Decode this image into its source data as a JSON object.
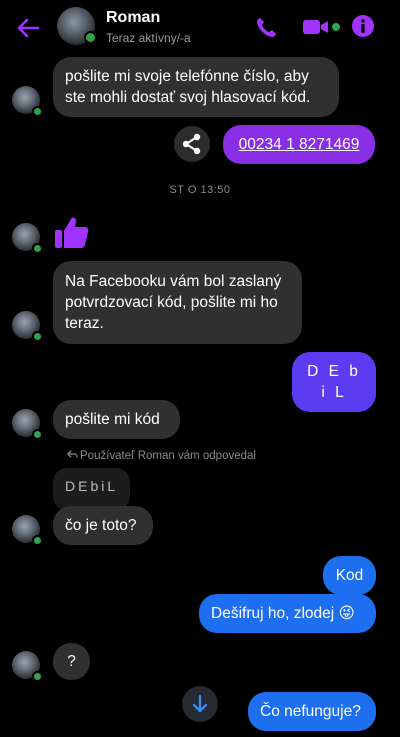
{
  "header": {
    "contact_name": "Roman",
    "status": "Teraz aktívny/-a",
    "back_icon": "back-arrow-icon",
    "call_icon": "phone-icon",
    "video_icon": "video-camera-icon",
    "info_icon": "info-icon",
    "accent_color": "#a033ff"
  },
  "messages": [
    {
      "from": "Roman",
      "text": "pošlite mi svoje telefónne číslo, aby ste mohli dostať svoj hlasovací kód."
    },
    {
      "from": "me",
      "text": "00234 1 8271469"
    },
    {
      "type": "timestamp",
      "text": "ST O 13:50"
    },
    {
      "from": "Roman",
      "text": "👍"
    },
    {
      "from": "Roman",
      "text": "Na Facebooku vám bol zaslaný potvrdzovací kód, pošlite mi ho teraz."
    },
    {
      "from": "me",
      "text": "D E b i L"
    },
    {
      "from": "Roman",
      "text": "pošlite mi kód"
    },
    {
      "type": "reply_note",
      "text": "Používateľ Roman vám odpovedal"
    },
    {
      "from": "Roman",
      "quoted": "DEbiL",
      "text": "čo je toto?"
    },
    {
      "from": "me",
      "text": "Kod"
    },
    {
      "from": "me",
      "text": "Dešifruj ho, zlodej 😜"
    },
    {
      "from": "Roman",
      "text": "?"
    },
    {
      "from": "me",
      "text": "Čo nefunguje?"
    }
  ],
  "controls": {
    "share_icon": "share-icon",
    "scroll_down_icon": "arrow-down-icon"
  }
}
